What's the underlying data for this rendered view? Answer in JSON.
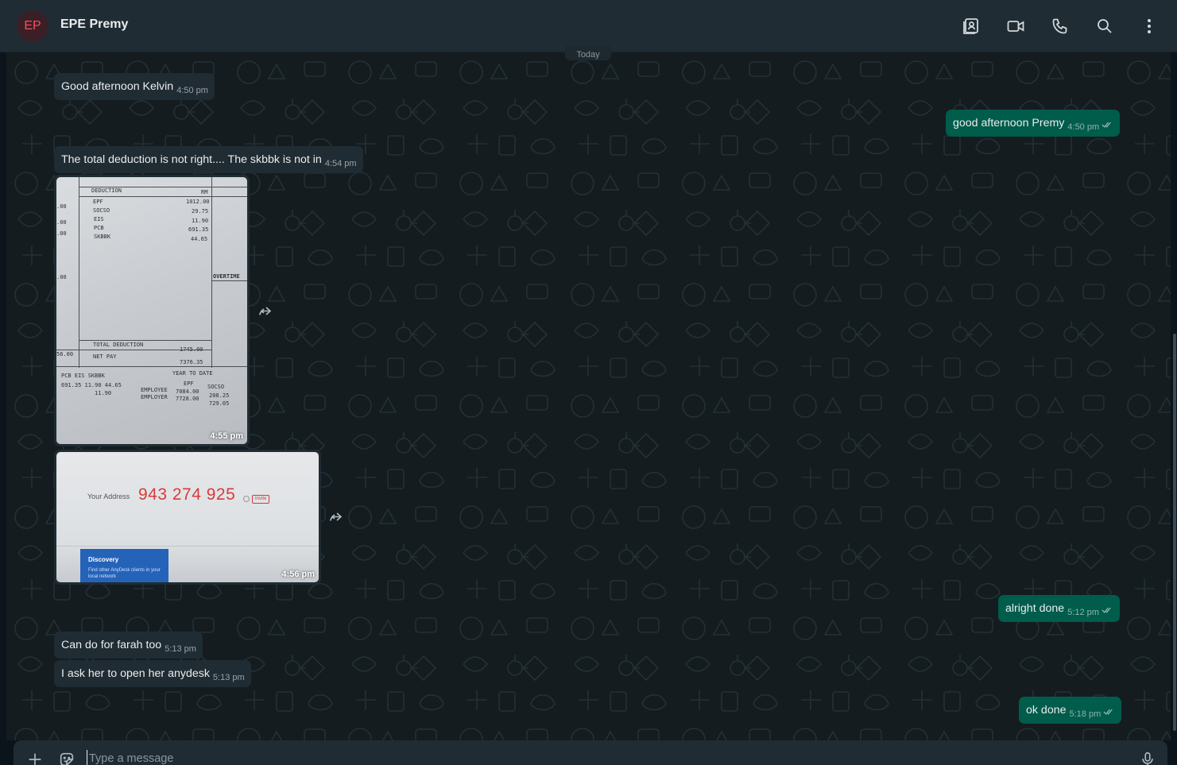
{
  "header": {
    "avatar_initials": "EP",
    "contact_name": "EPE Premy",
    "icons": [
      "contact-card-icon",
      "video-call-icon",
      "voice-call-icon",
      "search-icon",
      "more-options-icon"
    ]
  },
  "chat": {
    "date_divider": "Today",
    "messages": [
      {
        "dir": "in",
        "text": "Good afternoon Kelvin",
        "time": "4:50 pm"
      },
      {
        "dir": "out",
        "text": "good afternoon Premy",
        "time": "4:50 pm"
      },
      {
        "dir": "in",
        "text": "The total deduction is not right.... The skbbk is not in",
        "time": "4:54 pm"
      },
      {
        "dir": "in",
        "type": "image",
        "time": "4:55 pm"
      },
      {
        "dir": "in",
        "type": "image",
        "time": "4:56 pm"
      },
      {
        "dir": "out",
        "text": "alright done",
        "time": "5:12 pm"
      },
      {
        "dir": "in",
        "text": "Can do for farah too",
        "time": "5:13 pm"
      },
      {
        "dir": "in",
        "text": "I ask her to open her anydesk",
        "time": "5:13 pm"
      },
      {
        "dir": "out",
        "text": "ok done",
        "time": "5:18 pm"
      }
    ]
  },
  "payslip": {
    "deduction_header": "DEDUCTION",
    "rm_header": "RM",
    "rows": [
      {
        "label": "EPF",
        "value": "1012.00"
      },
      {
        "label": "SOCSO",
        "value": "29.75"
      },
      {
        "label": "EIS",
        "value": "11.90"
      },
      {
        "label": "PCB",
        "value": "691.35"
      },
      {
        "label": "SKBBK",
        "value": "44.65"
      }
    ],
    "overtime": "OVERTIME",
    "total_deduction_label": "TOTAL DEDUCTION",
    "total_deduction_value": "1745.00",
    "net_pay_label": "NET PAY",
    "net_pay_value": "7376.35",
    "year_to_date": "YEAR TO DATE",
    "ytd_cols": "PCB    EIS    SKBBK",
    "ytd_vals_1": "691.35   11.90   44.65",
    "ytd_vals_2": "11.90",
    "epf_label": "EPF",
    "socso_label": "SOCSO",
    "employee_label": "EMPLOYEE",
    "employer_label": "EMPLOYER",
    "employee_epf": "7084.00",
    "employer_epf": "7728.00",
    "employee_socso": "208.25",
    "employer_socso": "729.05",
    "left_vals": [
      ".00",
      ".00",
      ".00",
      ".00",
      "56.00"
    ]
  },
  "anydesk": {
    "your_address_label": "Your Address",
    "address": "943 274 925",
    "invite": "Invite",
    "discovery_title": "Discovery",
    "discovery_text": "Find other AnyDesk clients in your local network"
  },
  "composer": {
    "placeholder": "Type a message"
  },
  "colors": {
    "incoming_bubble": "#202c33",
    "outgoing_bubble": "#005c4b",
    "header_bg": "#202c33",
    "avatar_text": "#ff4b5c",
    "address_red": "#d93a3a"
  }
}
